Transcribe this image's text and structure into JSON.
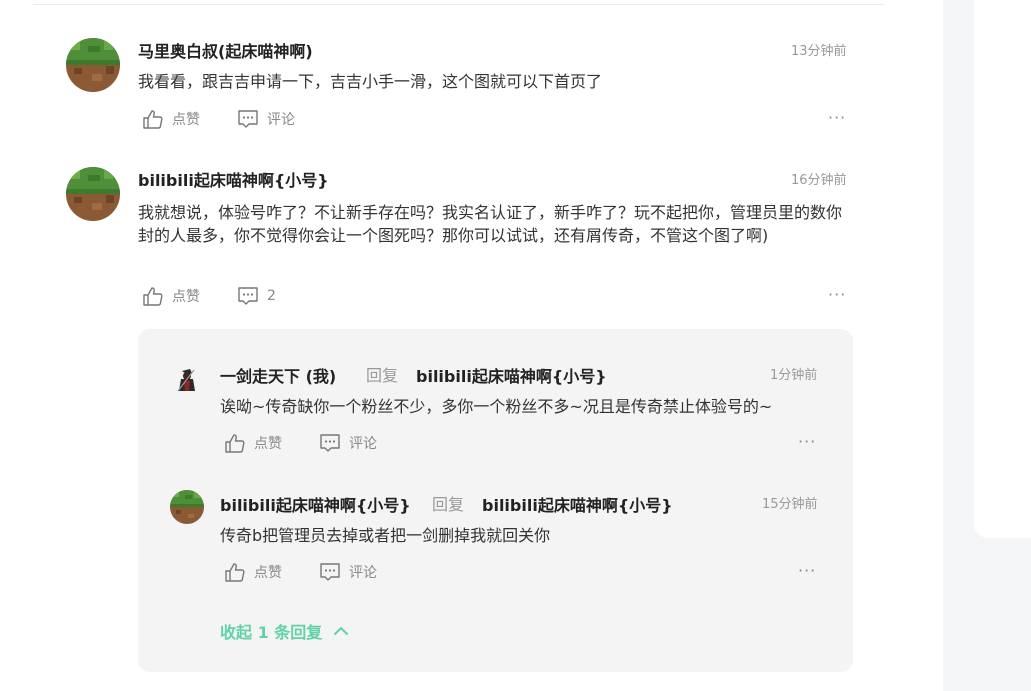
{
  "comments": [
    {
      "author": "马里奥白叔(起床喵神啊)",
      "time": "13分钟前",
      "text": "我看看，跟吉吉申请一下，吉吉小手一滑，这个图就可以下首页了",
      "like_label": "点赞",
      "comment_label": "评论",
      "avatar_icon": "grass-block-avatar"
    },
    {
      "author": "bilibili起床喵神啊{小号}",
      "time": "16分钟前",
      "text": "我就想说，体验号咋了？不让新手存在吗？我实名认证了，新手咋了？玩不起把你，管理员里的数你封的人最多，你不觉得你会让一个图死吗？那你可以试试，还有屑传奇，不管这个图了啊)",
      "like_label": "点赞",
      "comment_count": "2",
      "avatar_icon": "grass-block-avatar",
      "replies": [
        {
          "author": "一剑走天下 (我)",
          "reply_word": "回复",
          "reply_to": "bilibili起床喵神啊{小号}",
          "time": "1分钟前",
          "text": "诶呦~传奇缺你一个粉丝不少，多你一个粉丝不多~况且是传奇禁止体验号的~",
          "like_label": "点赞",
          "comment_label": "评论",
          "avatar_icon": "swordsman-avatar"
        },
        {
          "author": "bilibili起床喵神啊{小号}",
          "reply_word": "回复",
          "reply_to": "bilibili起床喵神啊{小号}",
          "time": "15分钟前",
          "text": "传奇b把管理员去掉或者把一剑删掉我就回关你",
          "like_label": "点赞",
          "comment_label": "评论",
          "avatar_icon": "grass-block-avatar"
        }
      ],
      "collapse_label": "收起 1 条回复"
    }
  ],
  "more_label": "···",
  "colors": {
    "accent": "#5fd2a8",
    "muted": "#999999",
    "reply_bg": "#f4f4f4"
  }
}
